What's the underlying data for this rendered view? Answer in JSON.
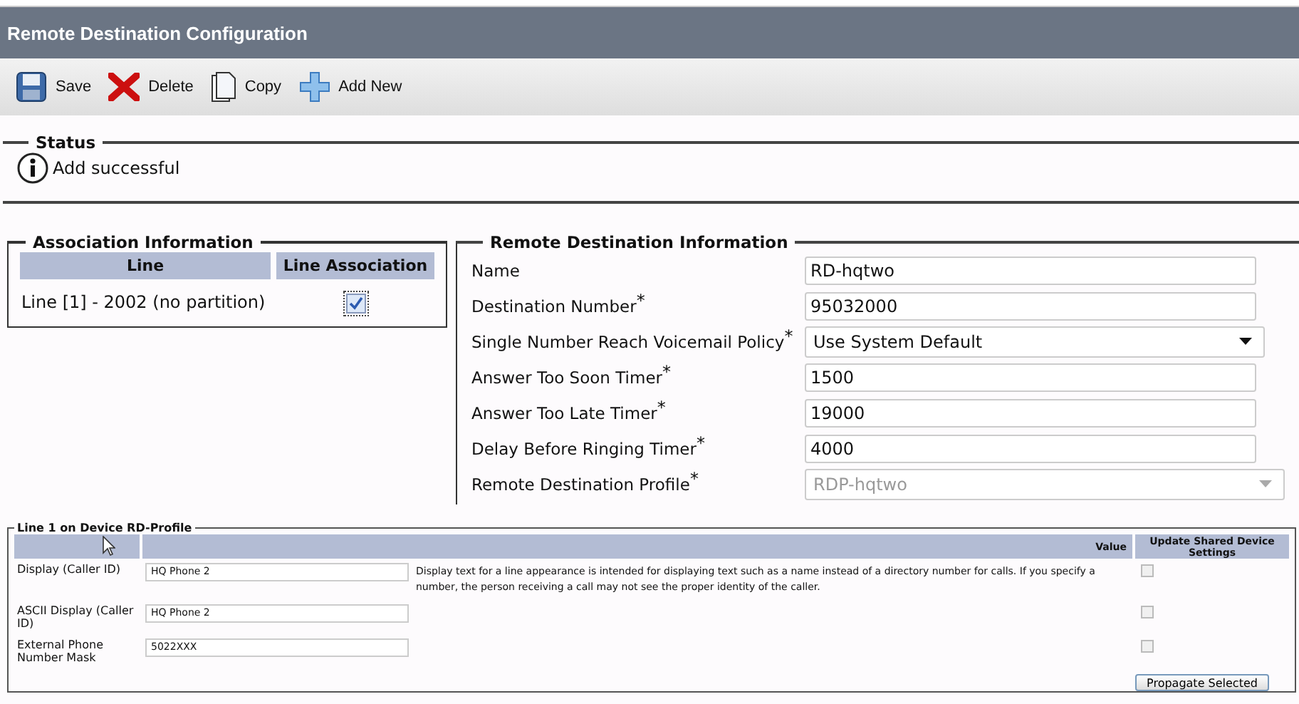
{
  "title": "Remote Destination Configuration",
  "toolbar": [
    {
      "kind": "save",
      "label": "Save"
    },
    {
      "kind": "delete",
      "label": "Delete"
    },
    {
      "kind": "copy",
      "label": "Copy"
    },
    {
      "kind": "add",
      "label": "Add New"
    }
  ],
  "status": {
    "legend": "Status",
    "message": "Add successful"
  },
  "association": {
    "legend": "Association Information",
    "columns": [
      "Line",
      "Line Association"
    ],
    "rows": [
      {
        "line": "Line [1] - 2002 (no partition)",
        "checked": true
      }
    ]
  },
  "remote": {
    "legend": "Remote Destination Information",
    "fields": [
      {
        "label": "Name",
        "kind": "input",
        "value": "RD-hqtwo"
      },
      {
        "label": "Destination Number",
        "required_mark": "*",
        "kind": "input",
        "value": "95032000"
      },
      {
        "label": "Single Number Reach Voicemail Policy",
        "required_mark": "*",
        "kind": "select",
        "value": "Use System Default",
        "disabled": false
      },
      {
        "label": "Answer Too Soon Timer",
        "required_mark": "*",
        "kind": "input",
        "value": "1500"
      },
      {
        "label": "Answer Too Late Timer",
        "required_mark": "*",
        "kind": "input",
        "value": "19000"
      },
      {
        "label": "Delay Before Ringing Timer",
        "required_mark": "*",
        "kind": "input",
        "value": "4000"
      },
      {
        "label": "Remote Destination Profile",
        "required_mark": "*",
        "kind": "select",
        "value": "RDP-hqtwo",
        "disabled": true
      }
    ]
  },
  "line_settings": {
    "legend": "Line 1 on Device RD-Profile",
    "columns": [
      "Value",
      "Update Shared Device Settings"
    ],
    "rows": [
      {
        "label": "Display (Caller ID)",
        "value": "HQ Phone 2",
        "description": "Display text for a line appearance is intended for displaying text such as a name instead of a directory number for calls. If you specify a number, the person receiving a call may not see the proper identity of the caller.",
        "checked": false
      },
      {
        "label": "ASCII Display (Caller ID)",
        "value": "HQ Phone 2",
        "checked": false
      },
      {
        "label": "External Phone Number Mask",
        "value": "5022XXX",
        "checked": false
      }
    ],
    "button": "Propagate Selected"
  }
}
